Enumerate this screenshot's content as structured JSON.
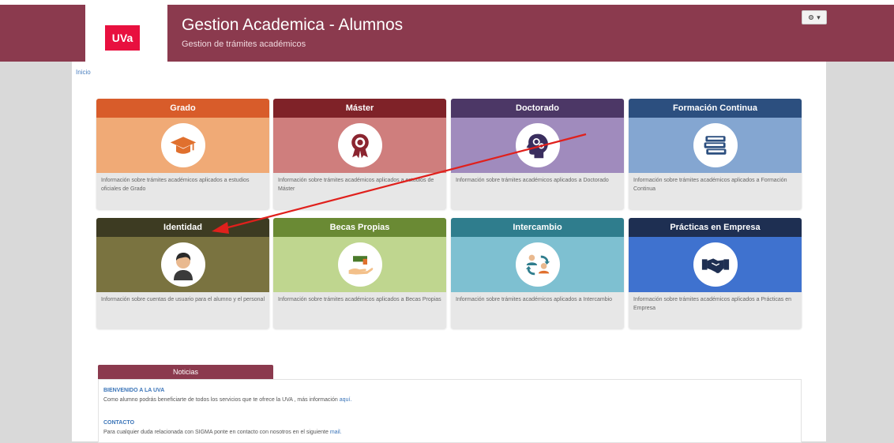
{
  "header": {
    "logo_text": "UVa",
    "title": "Gestion Academica - Alumnos",
    "subtitle": "Gestion de trámites académicos",
    "bg_color": "#8b3a4e",
    "logo_color": "#e8103f"
  },
  "settings_menu": {
    "icon": "gear-icon",
    "caret": "▾"
  },
  "breadcrumb": {
    "home": "Inicio"
  },
  "cards": [
    {
      "title": "Grado",
      "head_color": "#d85c2a",
      "img_color": "#f0aa76",
      "icon": "graduation-cap-icon",
      "icon_color": "#e0702e",
      "desc": "Información sobre trámites académicos aplicados a estudios oficiales de Grado"
    },
    {
      "title": "Máster",
      "head_color": "#7f2228",
      "img_color": "#cf7e7d",
      "icon": "award-ribbon-icon",
      "icon_color": "#8b2530",
      "desc": "Información sobre trámites académicos aplicados a estudios de Máster"
    },
    {
      "title": "Doctorado",
      "head_color": "#4c3766",
      "img_color": "#a08bbd",
      "icon": "head-gears-icon",
      "icon_color": "#3a2e5e",
      "desc": "Información sobre trámites académicos aplicados a Doctorado"
    },
    {
      "title": "Formación Continua",
      "head_color": "#2c4f7f",
      "img_color": "#84a6d1",
      "icon": "books-icon",
      "icon_color": "#2c4f7f",
      "desc": "Información sobre trámites académicos aplicados a Formación Continua"
    },
    {
      "title": "Identidad",
      "head_color": "#3d3b22",
      "img_color": "#7a7340",
      "icon": "user-icon",
      "icon_color": "#3a3a3a",
      "desc": "Información sobre cuentas de usuario para el alumno y el personal"
    },
    {
      "title": "Becas Propias",
      "head_color": "#6a8a34",
      "img_color": "#bfd68f",
      "icon": "hand-cap-icon",
      "icon_color": "#4a7a2a",
      "desc": "Información sobre trámites académicos aplicados a Becas Propias"
    },
    {
      "title": "Intercambio",
      "head_color": "#2f7d8d",
      "img_color": "#7ec0d1",
      "icon": "exchange-people-icon",
      "icon_color": "#2f7d8d",
      "desc": "Información sobre trámites académicos aplicados a Intercambio"
    },
    {
      "title": "Prácticas en Empresa",
      "head_color": "#1e2f52",
      "img_color": "#3f72cf",
      "icon": "handshake-icon",
      "icon_color": "#1e2f52",
      "desc": "Información sobre trámites académicos aplicados a Prácticas en Empresa"
    }
  ],
  "news": {
    "tab_label": "Noticias",
    "items": [
      {
        "title": "BIENVENIDO A LA UVA",
        "text": "Como alumno podrás beneficiarte de todos los servicios que te ofrece la UVA , más información",
        "link": "aquí."
      },
      {
        "title": "CONTACTO",
        "text": "Para cualquier duda relacionada con SIGMA ponte en contacto con nosotros en el siguiente",
        "link": "mail."
      }
    ]
  },
  "annotation_arrow_color": "#e0201c"
}
